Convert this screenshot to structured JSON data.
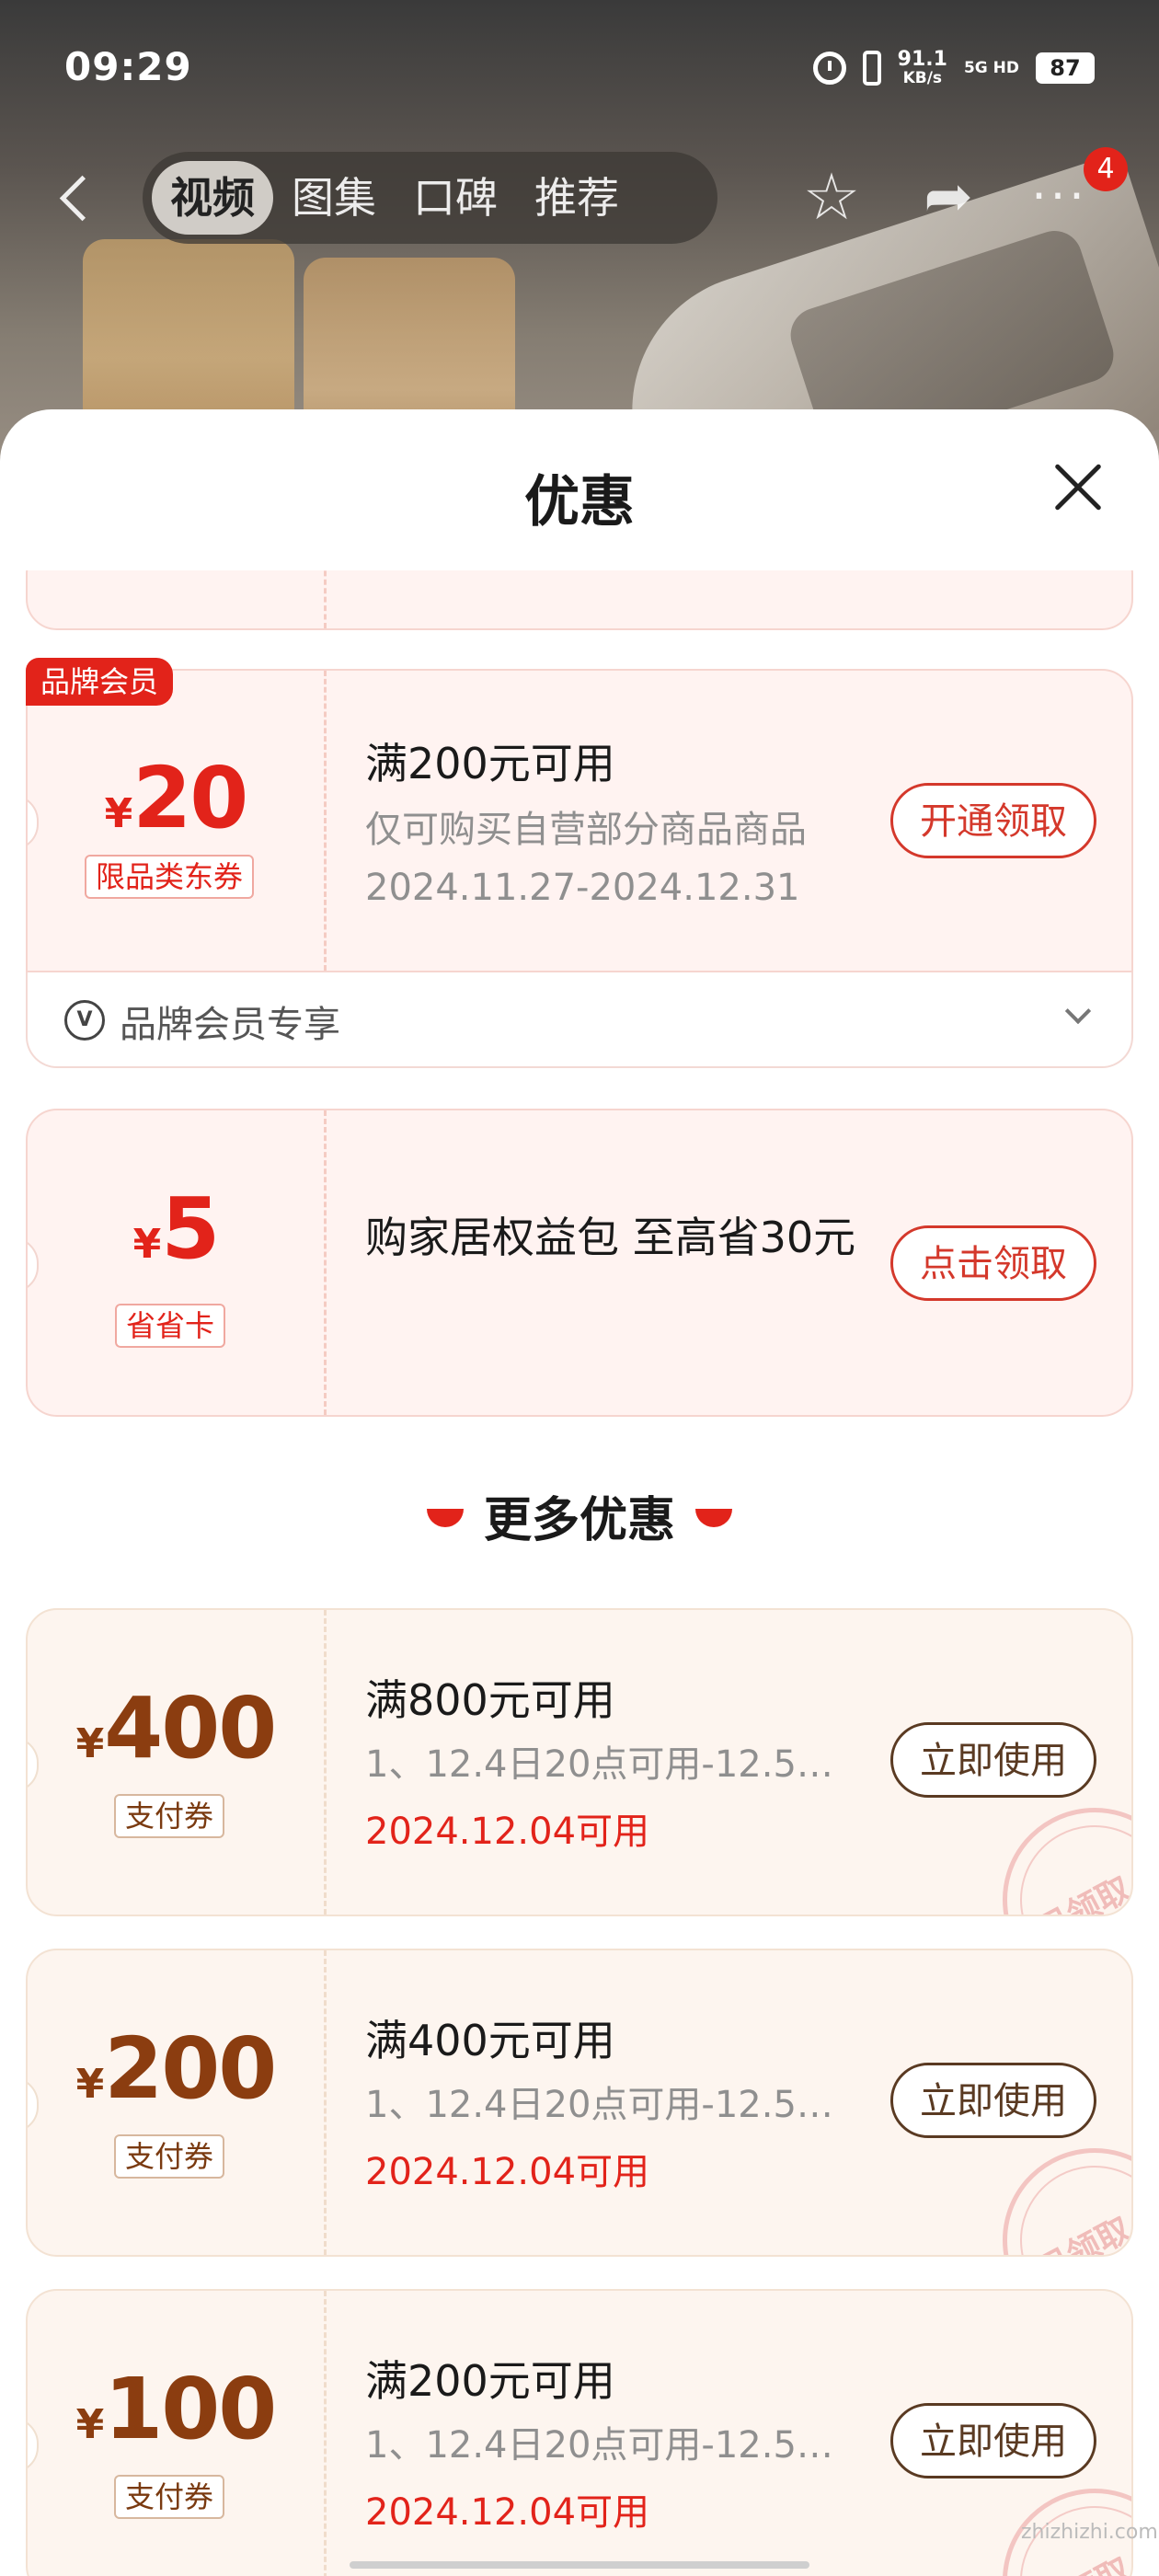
{
  "status": {
    "time": "09:29",
    "net_speed": "91.1",
    "net_unit": "KB/s",
    "signal": "5G HD",
    "battery": "87"
  },
  "nav": {
    "tabs": [
      "视频",
      "图集",
      "口碑",
      "推荐"
    ],
    "active_tab": "视频",
    "badge": "4"
  },
  "sheet": {
    "title": "优惠"
  },
  "coupons_top": [
    {
      "badge": "品牌会员",
      "currency": "¥",
      "amount": "20",
      "tag": "限品类东券",
      "title": "满200元可用",
      "sub": "仅可购买自营部分商品商品",
      "date": "2024.11.27-2024.12.31",
      "cta": "开通领取",
      "member_label": "品牌会员专享"
    },
    {
      "currency": "¥",
      "amount": "5",
      "tag": "省省卡",
      "desc": "购家居权益包 至高省30元",
      "cta": "点击领取"
    }
  ],
  "more_section": {
    "title": "更多优惠"
  },
  "coupons_more": [
    {
      "currency": "¥",
      "amount": "400",
      "tag": "支付券",
      "title": "满800元可用",
      "sub": "1、12.4日20点可用-12.5…",
      "date": "2024.12.04可用",
      "cta": "立即使用",
      "stamp": "已领取"
    },
    {
      "currency": "¥",
      "amount": "200",
      "tag": "支付券",
      "title": "满400元可用",
      "sub": "1、12.4日20点可用-12.5…",
      "date": "2024.12.04可用",
      "cta": "立即使用",
      "stamp": "已领取"
    },
    {
      "currency": "¥",
      "amount": "100",
      "tag": "支付券",
      "title": "满200元可用",
      "sub": "1、12.4日20点可用-12.5…",
      "date": "2024.12.04可用",
      "cta": "立即使用",
      "stamp": "已领取"
    }
  ],
  "watermark": "zhizhizhi.com"
}
